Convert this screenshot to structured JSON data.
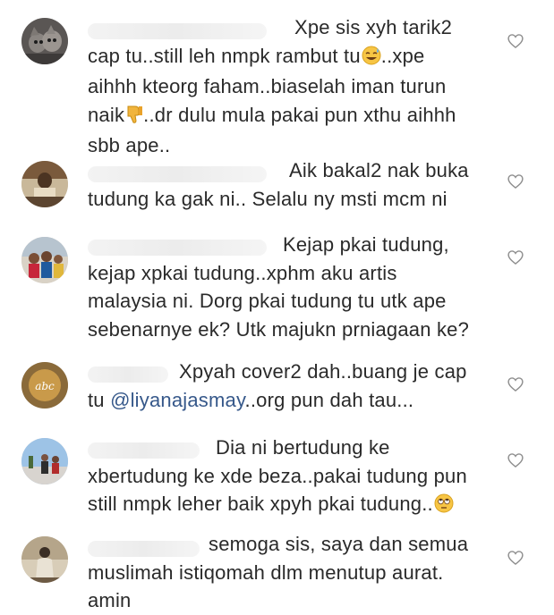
{
  "comments": [
    {
      "avatar": "cat-avatar",
      "lines": [
        "Xpe sis xyh tarik2",
        "cap tu..still leh nmpk rambut tu",
        "aihhh kteorg faham..biaselah iman turun",
        "naik",
        "sbb ape.."
      ],
      "line1_suffix": "..xpe",
      "line3_suffix": "..dr dulu mula pakai pun xthu aihhh",
      "emoji1": "sweat-smile-emoji",
      "emoji2": "thumbs-down-emoji"
    },
    {
      "avatar": "movie-poster-avatar",
      "lines": [
        "Aik bakal2 nak buka",
        "tudung ka gak ni.. Selalu ny msti mcm ni"
      ]
    },
    {
      "avatar": "group-photo-avatar",
      "lines": [
        "Kejap pkai tudung,",
        "kejap xpkai tudung..xphm aku artis",
        "malaysia ni. Dorg pkai tudung tu utk ape",
        "sebenarnye ek? Utk majukn prniagaan ke?"
      ]
    },
    {
      "avatar": "logo-avatar",
      "lines": [
        "Xpyah cover2 dah..buang je cap",
        "tu ",
        "..org pun dah tau..."
      ],
      "mention": "@liyanajasmay"
    },
    {
      "avatar": "outdoor-avatar",
      "lines": [
        "Dia ni bertudung ke",
        "xbertudung ke xde beza..pakai tudung pun",
        "still nmpk leher baik xpyh pkai tudung.."
      ],
      "emoji": "eye-roll-emoji"
    },
    {
      "avatar": "person-avatar",
      "lines": [
        "semoga sis, saya dan semua",
        "muslimah istiqomah dlm menutup aurat.",
        "amin"
      ]
    }
  ],
  "like_icon": "heart-outline-icon",
  "colors": {
    "text": "#2a2a2a",
    "mention": "#36588a",
    "icon": "#8e8e8e"
  }
}
